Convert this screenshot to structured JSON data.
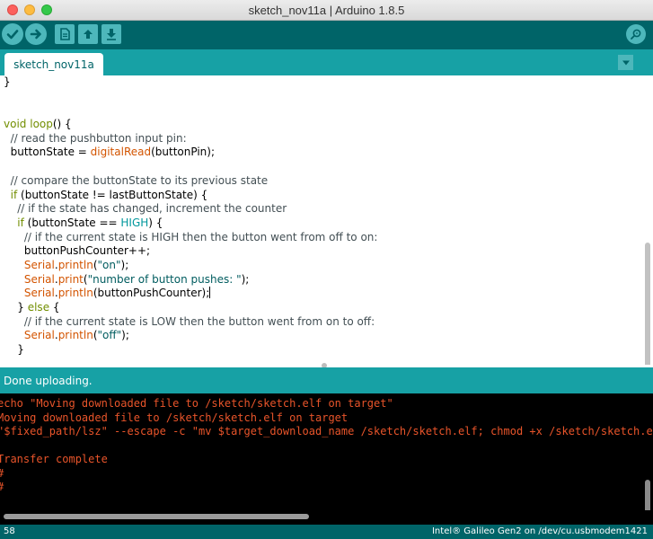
{
  "window": {
    "title": "sketch_nov11a | Arduino 1.8.5"
  },
  "toolbar": {
    "buttons": [
      {
        "name": "verify",
        "icon": "check-icon"
      },
      {
        "name": "upload",
        "icon": "arrow-right-icon"
      },
      {
        "name": "new",
        "icon": "document-icon"
      },
      {
        "name": "open",
        "icon": "arrow-up-icon"
      },
      {
        "name": "save",
        "icon": "arrow-down-icon"
      }
    ],
    "serial_monitor_icon": "magnifier-icon"
  },
  "tabs": [
    {
      "label": "sketch_nov11a"
    }
  ],
  "editor": {
    "lines": [
      [
        {
          "t": "}",
          "c": ""
        }
      ],
      [
        {
          "t": "",
          "c": ""
        }
      ],
      [
        {
          "t": "",
          "c": ""
        }
      ],
      [
        {
          "t": "void",
          "c": "kw"
        },
        {
          "t": " ",
          "c": ""
        },
        {
          "t": "loop",
          "c": "kw"
        },
        {
          "t": "() {",
          "c": ""
        }
      ],
      [
        {
          "t": "  // read the pushbutton input pin:",
          "c": "cm"
        }
      ],
      [
        {
          "t": "  buttonState = ",
          "c": ""
        },
        {
          "t": "digitalRead",
          "c": "fn"
        },
        {
          "t": "(buttonPin);",
          "c": ""
        }
      ],
      [
        {
          "t": "",
          "c": ""
        }
      ],
      [
        {
          "t": "  // compare the buttonState to its previous state",
          "c": "cm"
        }
      ],
      [
        {
          "t": "  ",
          "c": ""
        },
        {
          "t": "if",
          "c": "kw"
        },
        {
          "t": " (buttonState != lastButtonState) {",
          "c": ""
        }
      ],
      [
        {
          "t": "    // if the state has changed, increment the counter",
          "c": "cm"
        }
      ],
      [
        {
          "t": "    ",
          "c": ""
        },
        {
          "t": "if",
          "c": "kw"
        },
        {
          "t": " (buttonState == ",
          "c": ""
        },
        {
          "t": "HIGH",
          "c": "const"
        },
        {
          "t": ") {",
          "c": ""
        }
      ],
      [
        {
          "t": "      // if the current state is HIGH then the button went from off to on:",
          "c": "cm"
        }
      ],
      [
        {
          "t": "      buttonPushCounter++;",
          "c": ""
        }
      ],
      [
        {
          "t": "      ",
          "c": ""
        },
        {
          "t": "Serial",
          "c": "fn"
        },
        {
          "t": ".",
          "c": ""
        },
        {
          "t": "println",
          "c": "fn"
        },
        {
          "t": "(",
          "c": ""
        },
        {
          "t": "\"on\"",
          "c": "st"
        },
        {
          "t": ");",
          "c": ""
        }
      ],
      [
        {
          "t": "      ",
          "c": ""
        },
        {
          "t": "Serial",
          "c": "fn"
        },
        {
          "t": ".",
          "c": ""
        },
        {
          "t": "print",
          "c": "fn"
        },
        {
          "t": "(",
          "c": ""
        },
        {
          "t": "\"number of button pushes: \"",
          "c": "st"
        },
        {
          "t": ");",
          "c": ""
        }
      ],
      [
        {
          "t": "      ",
          "c": ""
        },
        {
          "t": "Serial",
          "c": "fn"
        },
        {
          "t": ".",
          "c": ""
        },
        {
          "t": "println",
          "c": "fn"
        },
        {
          "t": "(buttonPushCounter);",
          "c": ""
        },
        {
          "t": "",
          "c": "cursor"
        }
      ],
      [
        {
          "t": "    } ",
          "c": ""
        },
        {
          "t": "else",
          "c": "kw"
        },
        {
          "t": " {",
          "c": ""
        }
      ],
      [
        {
          "t": "      // if the current state is LOW then the button went from on to off:",
          "c": "cm"
        }
      ],
      [
        {
          "t": "      ",
          "c": ""
        },
        {
          "t": "Serial",
          "c": "fn"
        },
        {
          "t": ".",
          "c": ""
        },
        {
          "t": "println",
          "c": "fn"
        },
        {
          "t": "(",
          "c": ""
        },
        {
          "t": "\"off\"",
          "c": "st"
        },
        {
          "t": ");",
          "c": ""
        }
      ],
      [
        {
          "t": "    }",
          "c": ""
        }
      ]
    ]
  },
  "status": {
    "message": "Done uploading."
  },
  "console": {
    "lines": [
      "echo \"Moving downloaded file to /sketch/sketch.elf on target\"",
      "Moving downloaded file to /sketch/sketch.elf on target",
      "\"$fixed_path/lsz\" --escape -c \"mv $target_download_name /sketch/sketch.elf; chmod +x /sketch/sketch.elf\"",
      "",
      "Transfer complete",
      "#",
      "#"
    ]
  },
  "footer": {
    "line_number": "58",
    "board": "Intel® Galileo Gen2 on /dev/cu.usbmodem1421"
  },
  "colors": {
    "toolbar": "#006468",
    "tabstrip": "#17a1a5",
    "console_text": "#e8542a"
  }
}
